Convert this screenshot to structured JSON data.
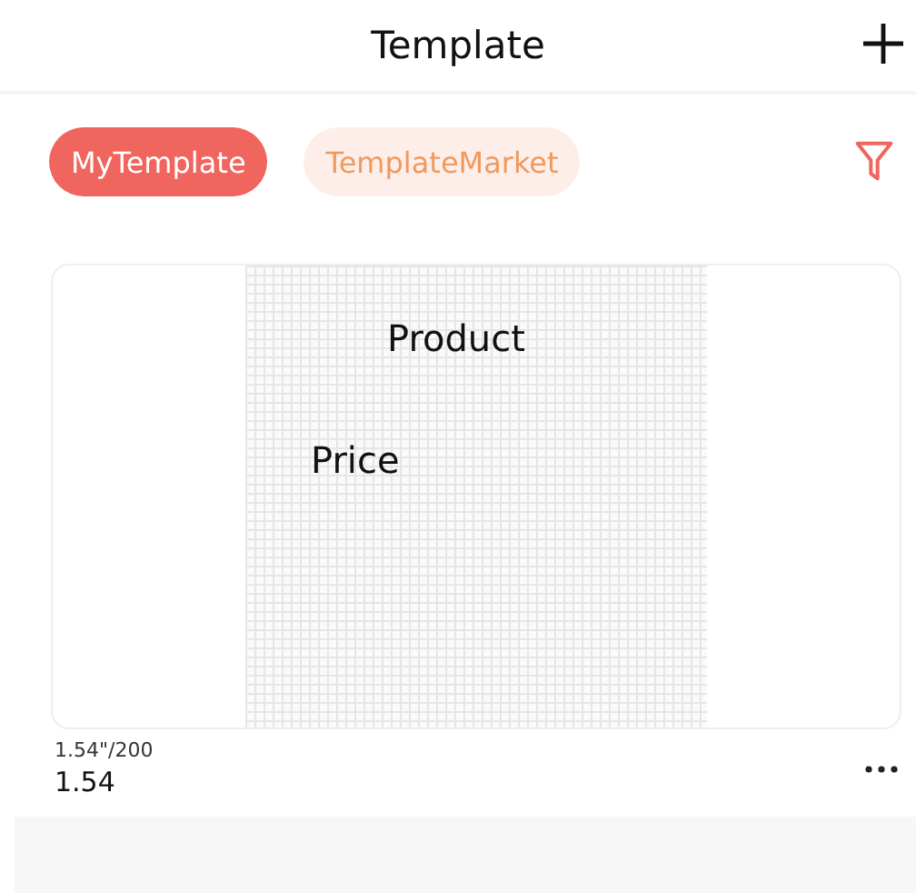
{
  "header": {
    "title": "Template"
  },
  "tabs": [
    {
      "label": "MyTemplate",
      "selected": true
    },
    {
      "label": "TemplateMarket",
      "selected": false
    }
  ],
  "templates": [
    {
      "label_texts": [
        "Product",
        "Price"
      ],
      "size": "1.54\"/200",
      "name": "1.54"
    }
  ]
}
